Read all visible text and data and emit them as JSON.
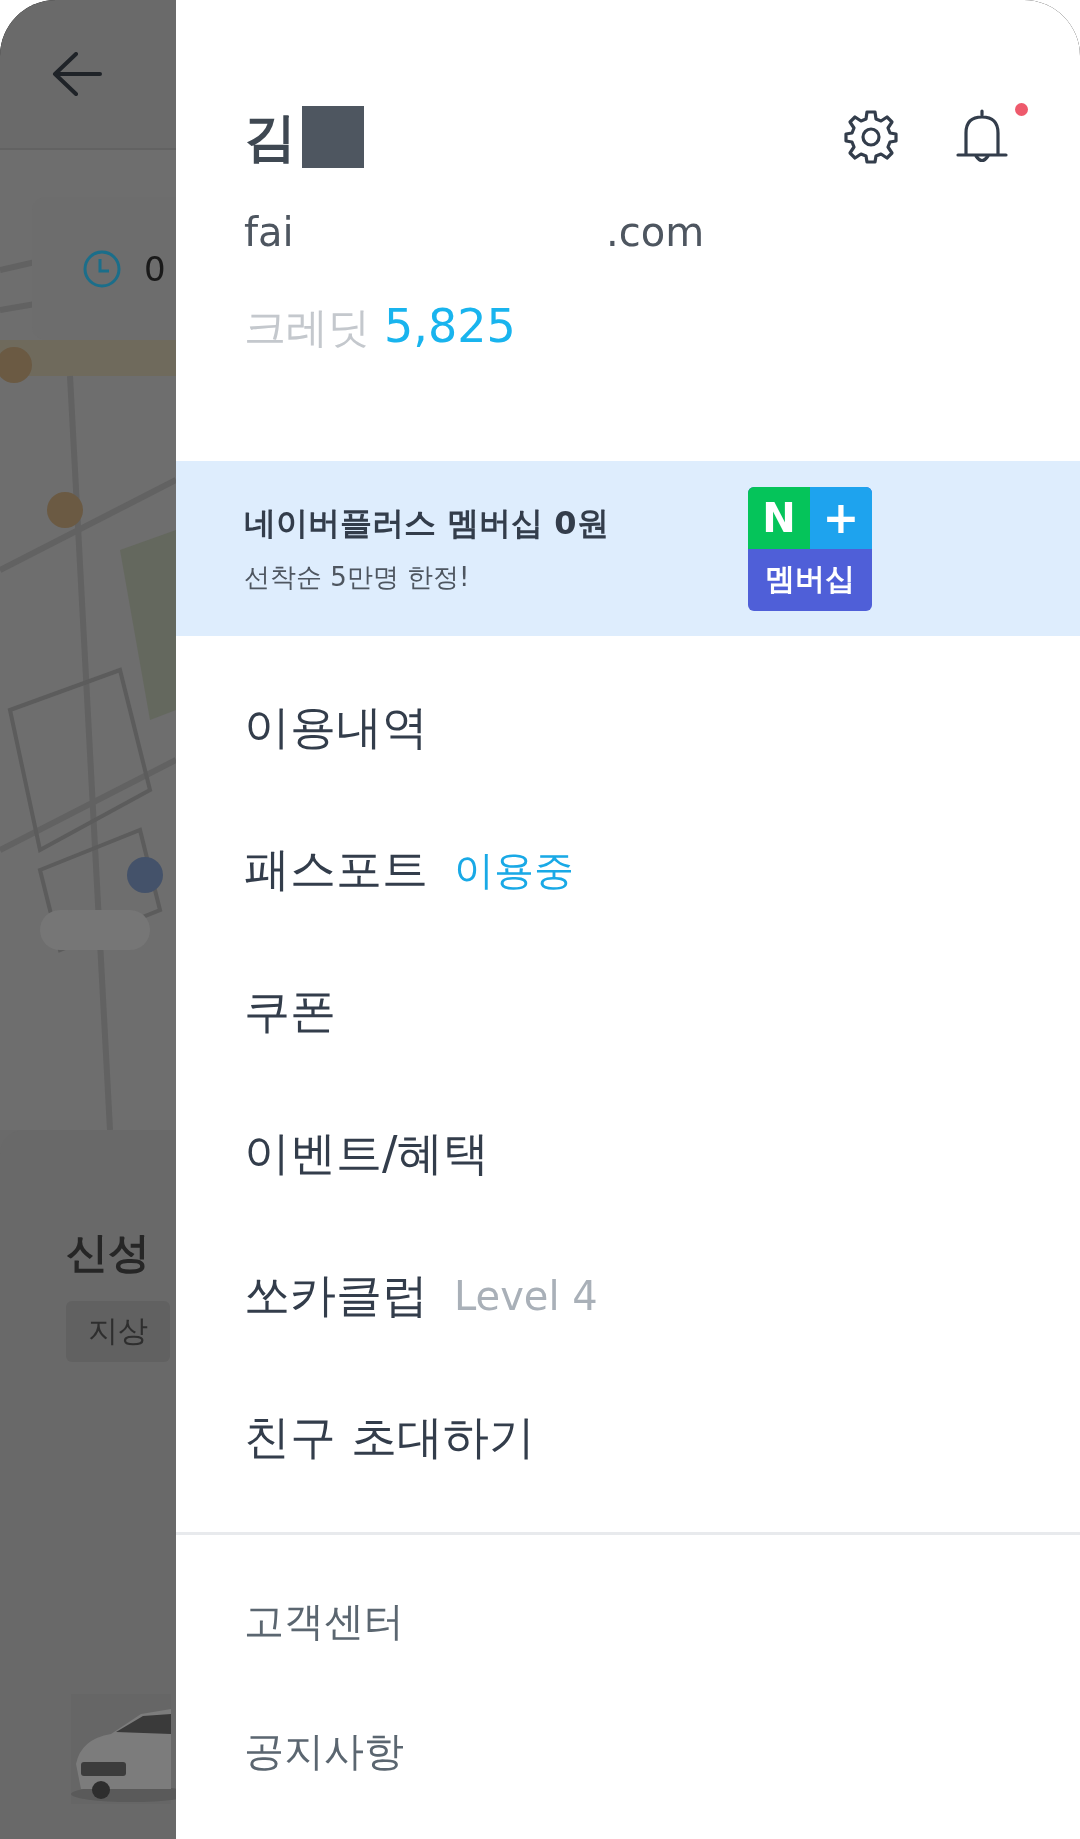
{
  "background": {
    "time_card": {
      "text": "0"
    },
    "sheet": {
      "title": "신성",
      "chip": "지상"
    }
  },
  "drawer": {
    "profile": {
      "name": "김",
      "email_start": "fai",
      "email_end": ".com",
      "credit_label": "크레딧",
      "credit_value": "5,825",
      "notification_unread": true
    },
    "banner": {
      "title": "네이버플러스 멤버십 0원",
      "subtitle": "선착순 5만명 한정!",
      "logo_letter": "N",
      "logo_plus": "+",
      "logo_label": "멤버십"
    },
    "menu": [
      {
        "label": "이용내역"
      },
      {
        "label": "패스포트",
        "tag": {
          "text": "이용중",
          "kind": "status"
        }
      },
      {
        "label": "쿠폰"
      },
      {
        "label": "이벤트/혜택"
      },
      {
        "label": "쏘카클럽",
        "tag": {
          "text": "Level 4",
          "kind": "level"
        }
      },
      {
        "label": "친구 초대하기"
      }
    ],
    "secondary_menu": [
      {
        "label": "고객센터"
      },
      {
        "label": "공지사항"
      }
    ]
  }
}
